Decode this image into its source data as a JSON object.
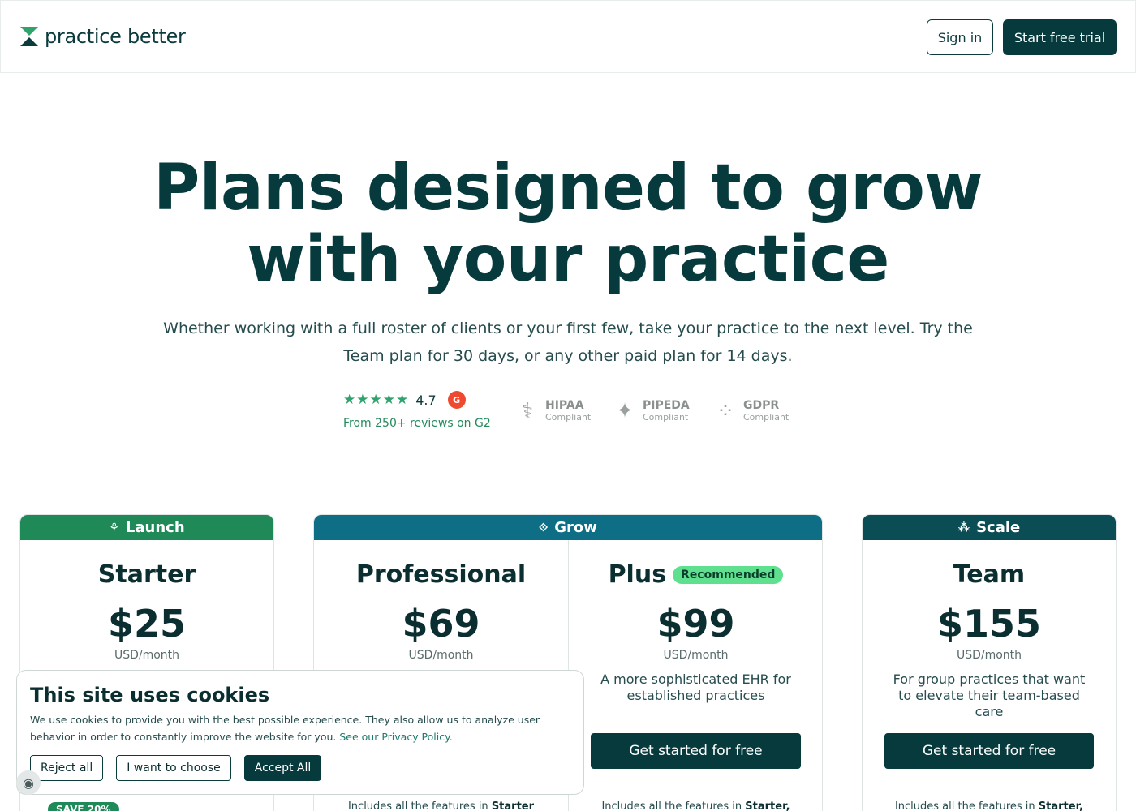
{
  "header": {
    "logo_text": "practice better",
    "signin_label": "Sign in",
    "trial_label": "Start free trial"
  },
  "hero": {
    "title_line1": "Plans designed to grow",
    "title_line2": "with your practice",
    "subtitle": "Whether working with a full roster of clients or your first few, take your practice to the next level. Try the Team plan for 30 days, or any other paid plan for 14 days."
  },
  "trust": {
    "stars": "★★★★★",
    "rating": "4.7",
    "g2_label": "G",
    "reviews": "From 250+ reviews on G2",
    "badges": [
      {
        "icon": "caduceus-icon",
        "glyph": "⚕",
        "name": "HIPAA",
        "sub": "Compliant"
      },
      {
        "icon": "maple-leaf-icon",
        "glyph": "✦",
        "name": "PIPEDA",
        "sub": "Compliant"
      },
      {
        "icon": "eu-stars-icon",
        "glyph": "⁘",
        "name": "GDPR",
        "sub": "Compliant"
      }
    ]
  },
  "pricing": {
    "groups": [
      {
        "label": "Launch",
        "glyph": "⚘",
        "color": "#1f8a58"
      },
      {
        "label": "Grow",
        "glyph": "⟐",
        "color": "#0d6e85"
      },
      {
        "label": "Scale",
        "glyph": "⁂",
        "color": "#0b4d55"
      }
    ],
    "plans": [
      {
        "name": "Starter",
        "price": "$25",
        "unit": "USD/month",
        "desc": "",
        "button": "",
        "includes_prefix": "",
        "includes_bold": ""
      },
      {
        "name": "Professional",
        "price": "$69",
        "unit": "USD/month",
        "desc": "",
        "button": "",
        "includes_prefix": "Includes all the features in ",
        "includes_bold": "Starter"
      },
      {
        "name": "Plus",
        "badge": "Recommended",
        "price": "$99",
        "unit": "USD/month",
        "desc": "A more sophisticated EHR for established practices",
        "button": "Get started for free",
        "includes_prefix": "Includes all the features in ",
        "includes_bold": "Starter,"
      },
      {
        "name": "Team",
        "price": "$155",
        "unit": "USD/month",
        "desc": "For group practices that want to elevate their team-based care",
        "button": "Get started for free",
        "includes_prefix": "Includes all the features in ",
        "includes_bold": "Starter,"
      }
    ],
    "save_label": "SAVE 20%"
  },
  "cookie": {
    "title": "This site uses cookies",
    "text": "We use cookies to provide you with the best possible experience. They also allow us to analyze user behavior in order to constantly improve the website for you.",
    "link": "See our Privacy Policy.",
    "reject": "Reject all",
    "choose": "I want to choose",
    "accept": "Accept All"
  }
}
